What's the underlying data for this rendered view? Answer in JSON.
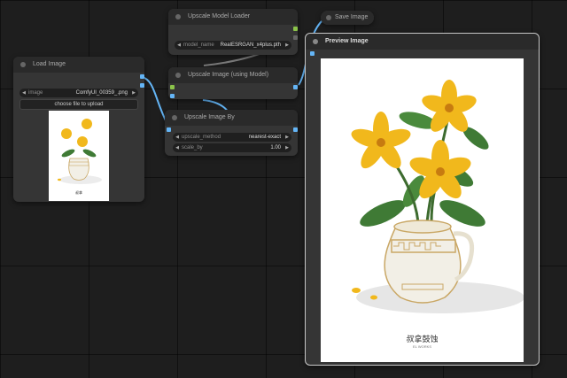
{
  "nodes": {
    "upscale_model_loader": {
      "title": "Upscale Model Loader",
      "widget_label": "model_name",
      "widget_value": "RealESRGAN_x4plus.pth"
    },
    "save_image": {
      "title": "Save Image"
    },
    "preview_image": {
      "title": "Preview Image",
      "caption": "叔拿鼓蚀",
      "subcaption": "EL WORKS"
    },
    "load_image": {
      "title": "Load Image",
      "widget_label": "image",
      "widget_value": "ComfyUI_00359_.png",
      "upload_label": "choose file to upload",
      "thumb_caption": "叔拿"
    },
    "upscale_image_using_model": {
      "title": "Upscale Image (using Model)"
    },
    "upscale_image_by": {
      "title": "Upscale Image By",
      "method_label": "upscale_method",
      "method_value": "nearest-exact",
      "scale_label": "scale_by",
      "scale_value": "1.00"
    }
  },
  "colors": {
    "link_image": "#64b5f6",
    "link_model": "#7a7a7a",
    "port_image": "#64b5f6",
    "port_model": "#8bc34a",
    "canvas": "#1e1e1e",
    "node_body": "#353535",
    "node_title": "#2a2a2a"
  }
}
